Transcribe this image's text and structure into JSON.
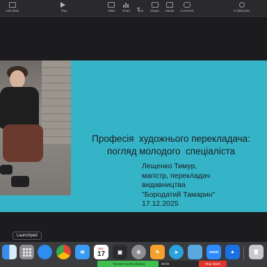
{
  "toolbar": {
    "add_slide": "Add Slide",
    "play": "Play",
    "table": "Table",
    "chart": "Chart",
    "text": "Text",
    "shape": "Shape",
    "media": "Media",
    "comment": "Comment",
    "collaborate": "Collaborate"
  },
  "slide": {
    "title_line1": "Професія  художнього перекладача:",
    "title_line2": "погляд молодого  спеціаліста",
    "author_name": "Лещенко Тимур,",
    "author_role": "магістр, перекладач",
    "author_org1": "видавництва",
    "author_org2": "\"Бородатий Тамарин\"",
    "date": "17.12.2025"
  },
  "tooltip": {
    "launchpad": "Launchpad"
  },
  "dock": {
    "calendar_month": "DEC",
    "calendar_day": "17",
    "zoom": "zoom",
    "icons": [
      "finder-icon",
      "launchpad-icon",
      "safari-icon",
      "chrome-icon",
      "mail-icon",
      "calendar-icon",
      "calculator-icon",
      "settings-icon",
      "pages-icon",
      "telegram-icon",
      "preview-icon",
      "zoom-icon",
      "keynote-icon",
      "trash-icon"
    ]
  },
  "screen_share": {
    "status": "You are screen sharing",
    "timer": "00:00",
    "stop": "Stop share"
  },
  "colors": {
    "slide_bg": "#35b4c8",
    "stop_share": "#e0342c",
    "share_bar": "#3fbf4f"
  }
}
